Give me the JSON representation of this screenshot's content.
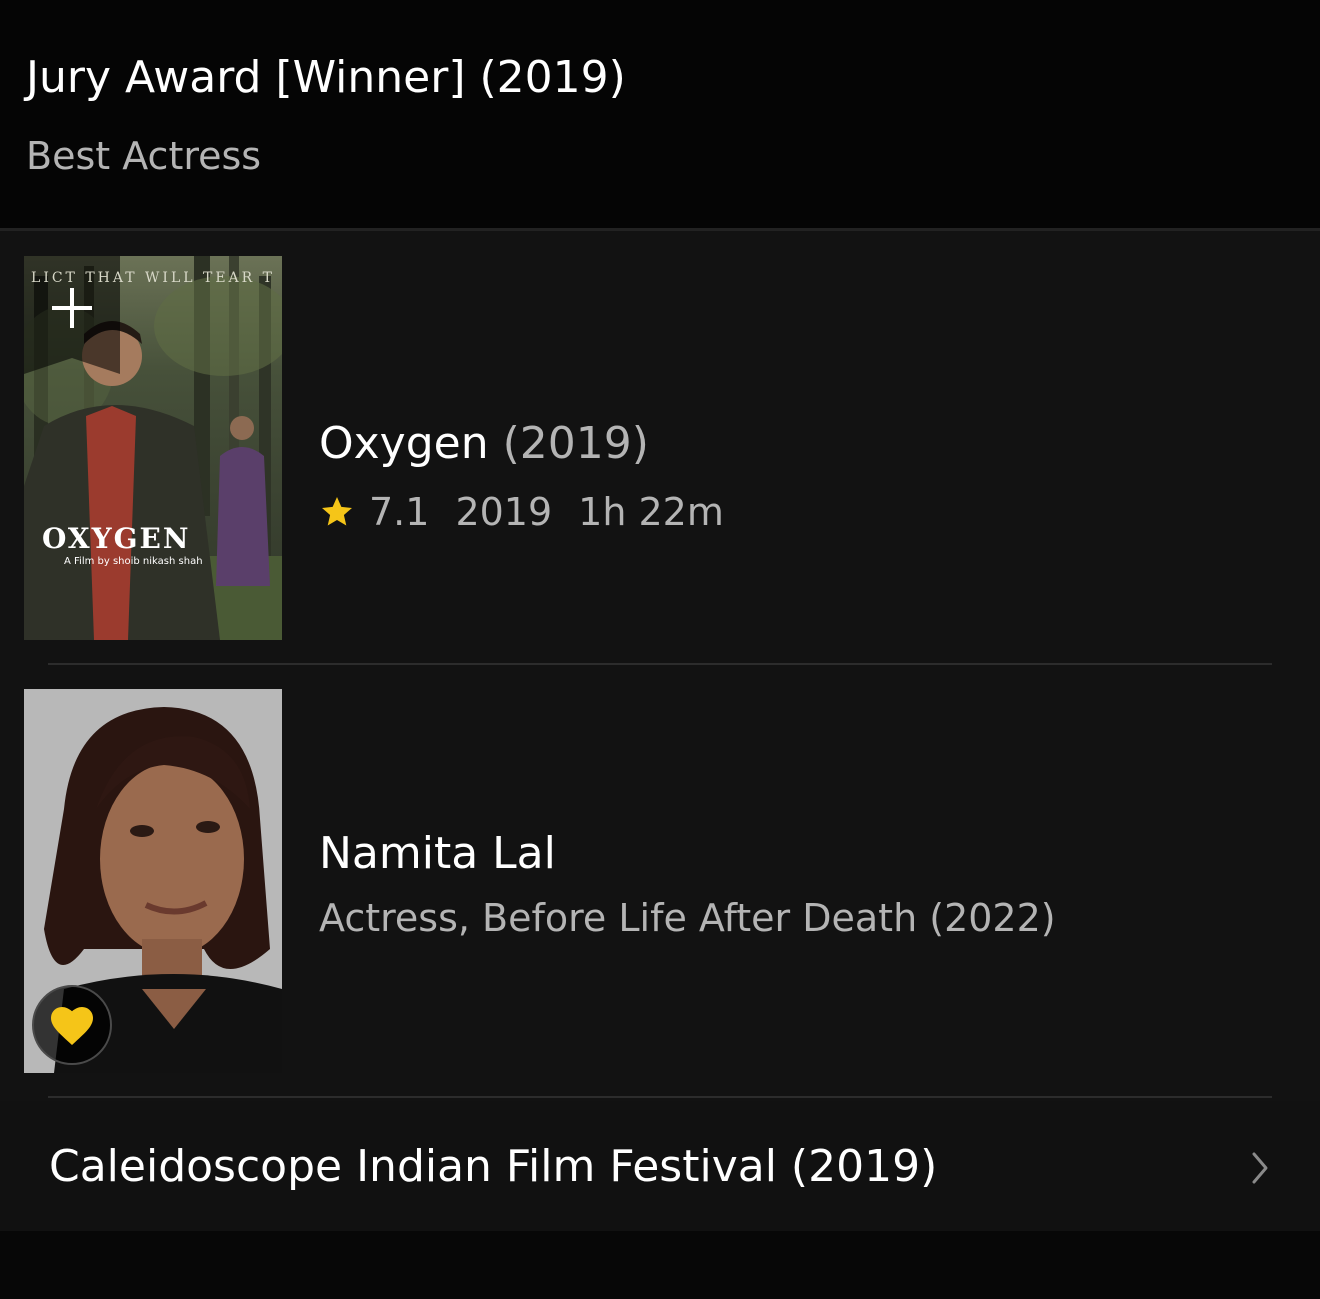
{
  "award": {
    "title": "Jury Award [Winner] (2019)",
    "category": "Best Actress"
  },
  "title_item": {
    "poster_tagline": "LICT THAT WILL TEAR T",
    "poster_title": "OXYGEN",
    "poster_credit": "A Film by shoib nikash shah",
    "title": "Oxygen",
    "title_year": "(2019)",
    "rating": "7.1",
    "year": "2019",
    "runtime": "1h 22m",
    "watchlist_icon": "plus-icon"
  },
  "name_item": {
    "name": "Namita Lal",
    "known_for": "Actress, Before Life After Death (2022)",
    "favorite_icon": "heart-icon"
  },
  "festival": {
    "label": "Caleidoscope Indian Film Festival (2019)",
    "icon": "chevron-right-icon"
  },
  "colors": {
    "background": "#070707",
    "card": "#121212",
    "accent_star": "#f5c518",
    "secondary_text": "#b4b4b4"
  }
}
